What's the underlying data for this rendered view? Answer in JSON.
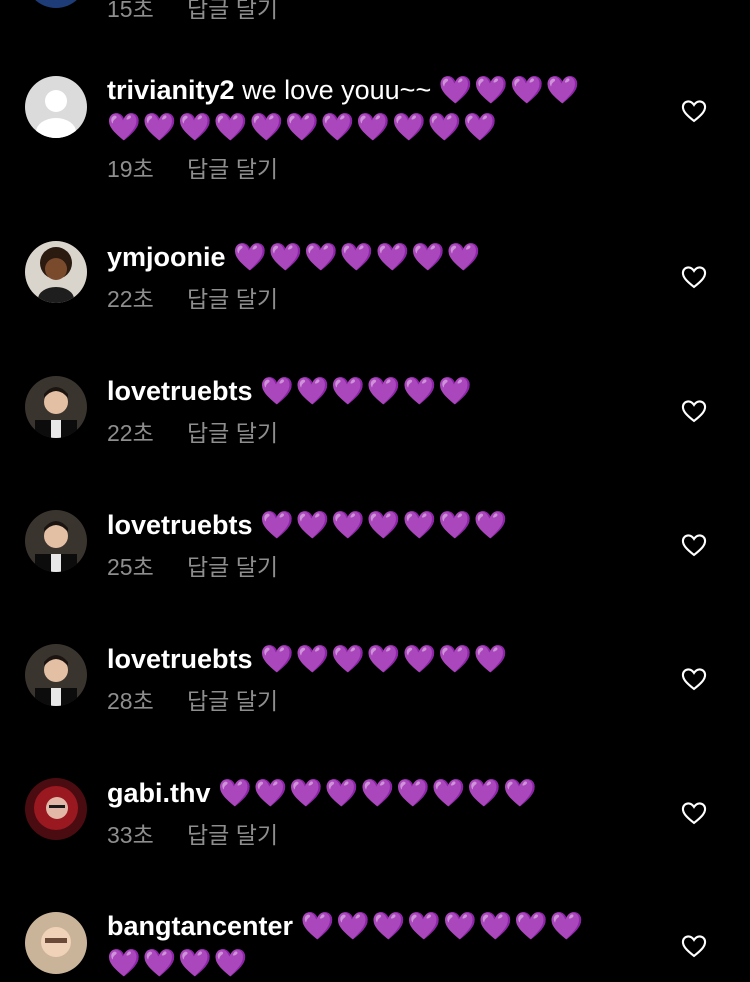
{
  "colors": {
    "background": "#000000",
    "heart": "#9b4dff",
    "meta_text": "#8e8e8e",
    "username": "#ffffff"
  },
  "top_partial": {
    "time": "15초",
    "reply": "답글 달기"
  },
  "comments": [
    {
      "username": "trivianity2",
      "text": "we love youu~~",
      "hearts": "💜💜💜💜",
      "hearts2": "💜💜💜💜💜💜💜💜💜💜💜",
      "time": "19초",
      "reply": "답글 달기",
      "avatar": "default-avatar"
    },
    {
      "username": "ymjoonie",
      "text": "",
      "hearts": "💜💜💜💜💜💜💜",
      "time": "22초",
      "reply": "답글 달기",
      "avatar": "cartoon-avatar"
    },
    {
      "username": "lovetruebts",
      "text": "",
      "hearts": "💜💜💜💜💜💜",
      "time": "22초",
      "reply": "답글 달기",
      "avatar": "photo-avatar"
    },
    {
      "username": "lovetruebts",
      "text": "",
      "hearts": "💜💜💜💜💜💜💜",
      "time": "25초",
      "reply": "답글 달기",
      "avatar": "photo-avatar"
    },
    {
      "username": "lovetruebts",
      "text": "",
      "hearts": "💜💜💜💜💜💜💜",
      "time": "28초",
      "reply": "답글 달기",
      "avatar": "photo-avatar"
    },
    {
      "username": "gabi.thv",
      "text": "",
      "hearts": "💜💜💜💜💜💜💜💜💜",
      "time": "33초",
      "reply": "답글 달기",
      "avatar": "red-hair-avatar"
    },
    {
      "username": "bangtancenter",
      "text": "",
      "hearts": "💜💜💜💜💜💜💜💜",
      "hearts2": "💜💜💜💜",
      "avatar": "selfie-avatar"
    }
  ]
}
